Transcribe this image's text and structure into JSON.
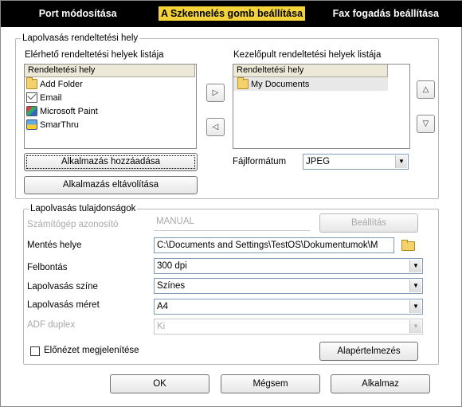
{
  "tabs": [
    {
      "label": "Port módosítása"
    },
    {
      "label": "A Szkennelés gomb beállítása"
    },
    {
      "label": "Fax fogadás beállítása"
    }
  ],
  "destinations": {
    "legend": "Lapolvasás rendeltetési hely",
    "available_label": "Elérhető rendeltetési helyek listája",
    "panel_label": "Kezelőpult rendeltetési helyek listája",
    "column_header": "Rendeltetési hely",
    "available_items": [
      {
        "label": "Add Folder",
        "icon": "folder-icon"
      },
      {
        "label": "Email",
        "icon": "email-icon"
      },
      {
        "label": "Microsoft Paint",
        "icon": "paint-icon"
      },
      {
        "label": "SmarThru",
        "icon": "smarthru-icon"
      }
    ],
    "panel_items": [
      {
        "label": "My Documents",
        "icon": "folder-icon"
      }
    ],
    "add_app_button": "Alkalmazás hozzáadása",
    "remove_app_button": "Alkalmazás eltávolítása",
    "file_format_label": "Fájlformátum",
    "file_format_value": "JPEG"
  },
  "properties": {
    "legend": "Lapolvasás tulajdonságok",
    "computer_id_label": "Számítógép azonosító",
    "computer_id_value": "MANUAL",
    "settings_button": "Beállítás",
    "save_location_label": "Mentés helye",
    "save_location_value": "C:\\Documents and Settings\\TestOS\\Dokumentumok\\M",
    "resolution_label": "Felbontás",
    "resolution_value": "300 dpi",
    "color_label": "Lapolvasás színe",
    "color_value": "Színes",
    "size_label": "Lapolvasás méret",
    "size_value": "A4",
    "duplex_label": "ADF duplex",
    "duplex_value": "Ki",
    "preview_label": "Előnézet megjelenítése",
    "preview_checked": false,
    "defaults_button": "Alapértelmezés"
  },
  "footer": {
    "ok": "OK",
    "cancel": "Mégsem",
    "apply": "Alkalmaz"
  },
  "colors": {
    "tab_bar": "#000000",
    "active_tab": "#f4d23a"
  }
}
